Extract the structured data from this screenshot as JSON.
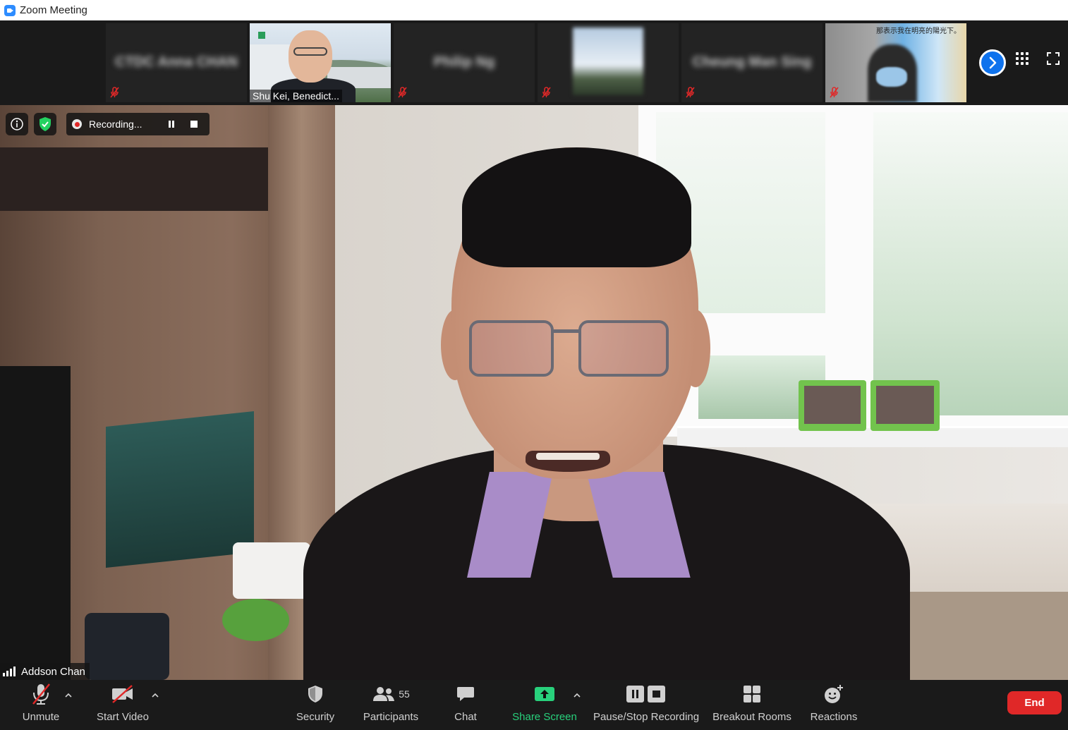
{
  "window": {
    "title": "Zoom Meeting"
  },
  "strip": {
    "tiles": [
      {
        "name": "CTDC Anna CHAN",
        "blurred": true
      },
      {
        "name": "Shu Kei, Benedict...",
        "blurred": false
      },
      {
        "name": "Philip Ng",
        "blurred": true
      },
      {
        "name": "",
        "blurred": true
      },
      {
        "name": "Cheung Man Sing",
        "blurred": true
      },
      {
        "name": "",
        "blurred": true,
        "caption": "那表示我在明亮的陽光下。"
      }
    ]
  },
  "recording": {
    "status": "Recording..."
  },
  "active_speaker": {
    "name": "Addson Chan"
  },
  "toolbar": {
    "unmute": "Unmute",
    "start_video": "Start Video",
    "security": "Security",
    "participants": "Participants",
    "participants_count": "55",
    "chat": "Chat",
    "share_screen": "Share Screen",
    "pause_stop_recording": "Pause/Stop Recording",
    "breakout_rooms": "Breakout Rooms",
    "reactions": "Reactions",
    "end": "End"
  },
  "colors": {
    "accent_blue": "#0e72ed",
    "share_green": "#28d17c",
    "end_red": "#e02828",
    "mute_red": "#e02828"
  }
}
